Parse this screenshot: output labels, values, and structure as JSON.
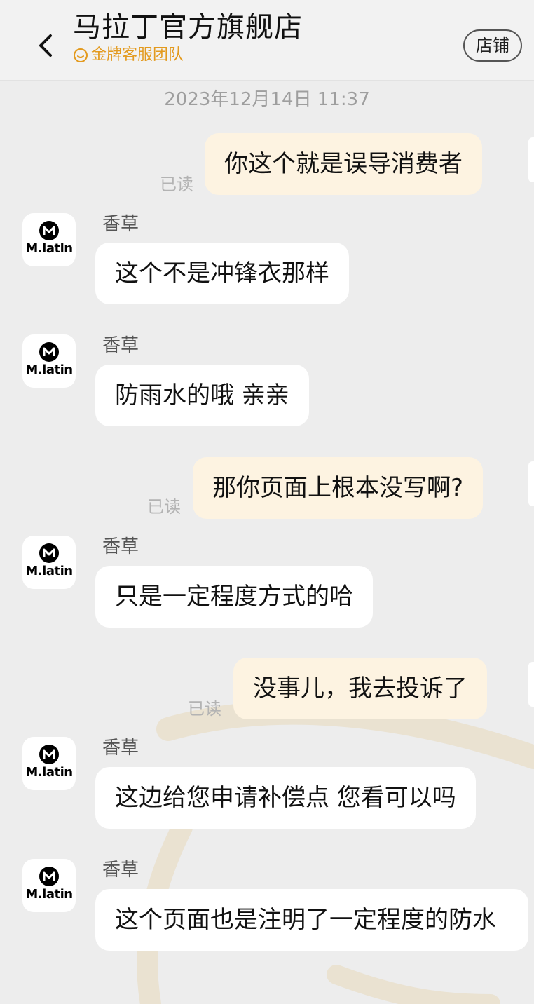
{
  "header": {
    "title": "马拉丁官方旗舰店",
    "subtitle": "金牌客服团队",
    "shop_button": "店铺",
    "accent_color": "#e39a1e"
  },
  "timestamp": "2023年12月14日 11:37",
  "messages": [
    {
      "side": "out",
      "text": "你这个就是误导消费者",
      "status": "已读"
    },
    {
      "side": "in",
      "sender": "香草",
      "avatar_text": "M.latin",
      "text": "这个不是冲锋衣那样"
    },
    {
      "side": "in",
      "sender": "香草",
      "avatar_text": "M.latin",
      "text": "防雨水的哦 亲亲"
    },
    {
      "side": "out",
      "text": "那你页面上根本没写啊?",
      "status": "已读"
    },
    {
      "side": "in",
      "sender": "香草",
      "avatar_text": "M.latin",
      "text": "只是一定程度方式的哈"
    },
    {
      "side": "out",
      "text": "没事儿，我去投诉了",
      "status": "已读"
    },
    {
      "side": "in",
      "sender": "香草",
      "avatar_text": "M.latin",
      "text": "这边给您申请补偿点 您看可以吗"
    },
    {
      "side": "in",
      "sender": "香草",
      "avatar_text": "M.latin",
      "text": "这个页面也是注明了一定程度的防水"
    }
  ]
}
